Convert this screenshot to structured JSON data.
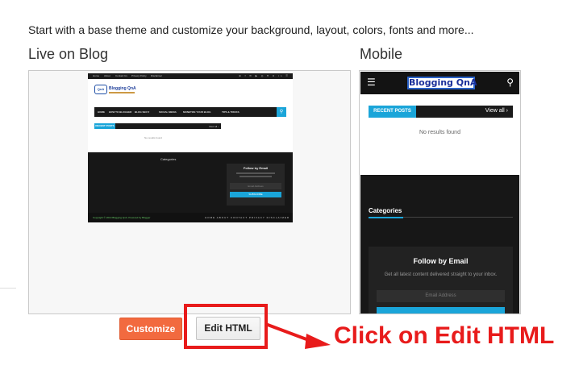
{
  "intro_text": "Start with a base theme and customize your background, layout, colors, fonts and more...",
  "sections": {
    "live_on_blog": "Live on Blog",
    "mobile": "Mobile"
  },
  "desktop_preview": {
    "top_links": [
      "Home",
      "About",
      "Contact Us",
      "Privacy Policy",
      "Disclaimer"
    ],
    "social_icons": "⊕ f ✉ ▶ ◎ ♥ ⊙ in ☰",
    "logo_badge": "QnA",
    "logo_text": "Blogging QnA",
    "nav_items": [
      "HOME",
      "HOW TO BLOGGER",
      "BLOG SEO ▾",
      "SOCIAL MEDIA",
      "MONETIZE YOUR BLOG",
      "TIPS & TRICKS"
    ],
    "recent_posts": "RECENT POSTS",
    "view_all": "View all ›",
    "no_results": "No results found",
    "categories": "Categories",
    "follow_title": "Follow by Email",
    "email_placeholder": "Email Address",
    "subscribe": "SUBSCRIBE",
    "copyright": "Copyright © 2019 Blogging QnA. Powered by Blogger",
    "footer_links": "HOME ABOUT CONTACT PRIVACY DISCLAIMER"
  },
  "mobile_preview": {
    "menu_icon": "☰",
    "brand": "Blogging QnA",
    "search_icon": "⚲",
    "recent_posts": "RECENT POSTS",
    "view_all": "View all ›",
    "no_results": "No results found",
    "categories": "Categories",
    "follow_title": "Follow by Email",
    "follow_desc": "Get all latest content delivered straight to your inbox.",
    "email_placeholder": "Email Address"
  },
  "buttons": {
    "customize": "Customize",
    "edit_html": "Edit HTML"
  },
  "annotation": {
    "text": "Click on Edit HTML",
    "color": "#e81b1b"
  },
  "colors": {
    "accent": "#1aa5d9",
    "customize_button": "#f26a3f"
  }
}
